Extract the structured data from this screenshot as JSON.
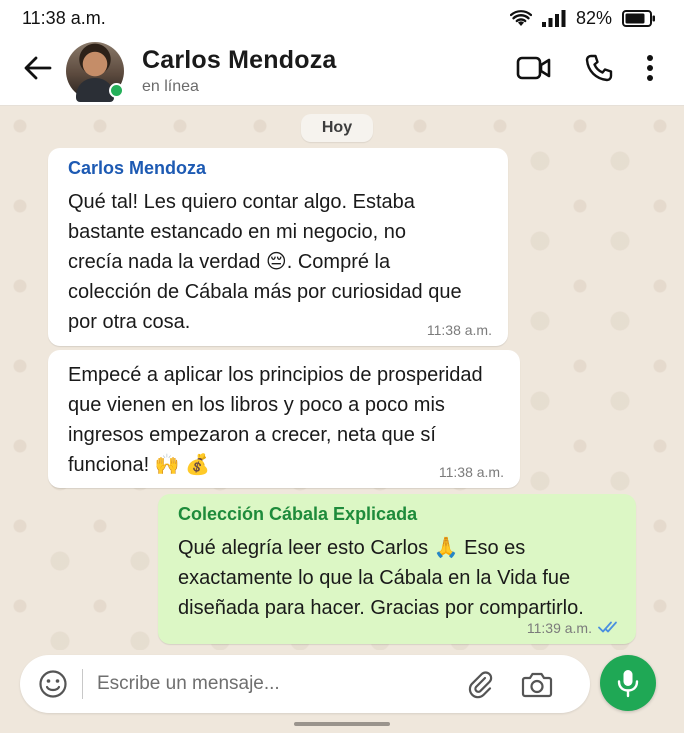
{
  "status_bar": {
    "time": "11:38 a.m.",
    "battery_percent": "82%",
    "icons": [
      "wifi-icon",
      "signal-icon",
      "battery-icon"
    ]
  },
  "header": {
    "contact_name": "Carlos Mendoza",
    "contact_status": "en línea",
    "icons": [
      "back-arrow-icon",
      "video-call-icon",
      "phone-icon",
      "more-options-icon"
    ]
  },
  "chat": {
    "date_label": "Hoy",
    "messages": [
      {
        "direction": "incoming",
        "sender": "Carlos Mendoza",
        "text": "Qué tal! Les quiero contar algo. Estaba\nbastante estancado en mi negocio, no\ncrecía nada la verdad 😔. Compré la\ncolección de Cábala más por curiosidad que\npor otra cosa.",
        "time": "11:38 a.m."
      },
      {
        "direction": "incoming",
        "sender": "",
        "text": "Empecé a aplicar los principios de prosperidad\nque vienen en los libros y poco a poco mis\ningresos empezaron a crecer, neta que sí\nfunciona! 🙌 💰",
        "time": "11:38 a.m."
      },
      {
        "direction": "outgoing",
        "sender": "Colección Cábala Explicada",
        "text": "Qué alegría leer esto Carlos 🙏 Eso es\nexactamente lo que la Cábala en la Vida fue\ndiseñada para hacer. Gracias por compartirlo.",
        "time": "11:39 a.m.",
        "read_receipt": "double-check-icon"
      }
    ]
  },
  "composer": {
    "placeholder": "Escribe un mensaje...",
    "value": "",
    "icons": [
      "emoji-icon",
      "paperclip-icon",
      "camera-icon",
      "microphone-icon"
    ]
  },
  "colors": {
    "accent_green": "#1fa855",
    "outgoing_bubble": "#dcf7c5",
    "incoming_sender": "#1d5ab3",
    "outgoing_sender": "#1e8b3b",
    "read_receipt": "#4a8fe0",
    "chat_background": "#efe7dc"
  }
}
